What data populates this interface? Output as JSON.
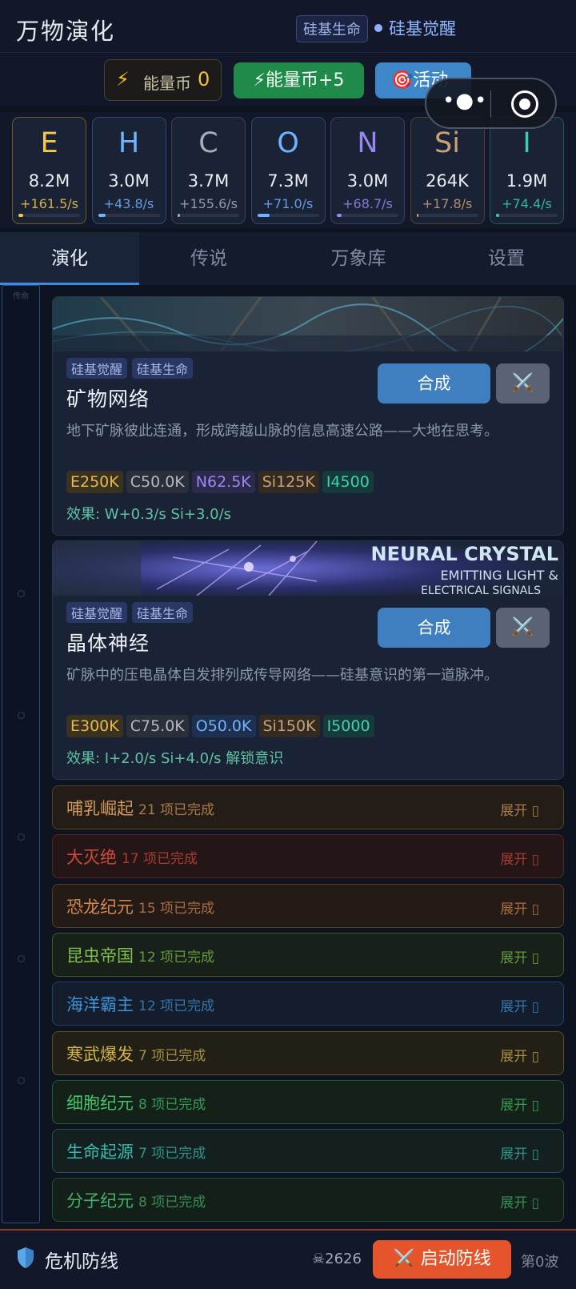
{
  "header": {
    "title": "万物演化",
    "stage_badge": "硅基生命",
    "stage_current": "硅基觉醒"
  },
  "energy": {
    "bolt_icon": "⚡",
    "label": "能量币",
    "value": "0",
    "add_button": "⚡能量币+5",
    "activity_button": "🎯活动"
  },
  "resources": [
    {
      "symbol": "E",
      "amount": "8.2M",
      "rate": "+161.5/s",
      "color": "#f6c84a",
      "border": "#6e5b26",
      "fill": 0.08
    },
    {
      "symbol": "H",
      "amount": "3.0M",
      "rate": "+43.8/s",
      "color": "#6fb2ff",
      "border": "#2f4a73",
      "fill": 0.12
    },
    {
      "symbol": "C",
      "amount": "3.7M",
      "rate": "+155.6/s",
      "color": "#a8adb8",
      "border": "#3b4150",
      "fill": 0.04
    },
    {
      "symbol": "O",
      "amount": "7.3M",
      "rate": "+71.0/s",
      "color": "#6fb2ff",
      "border": "#2f4a73",
      "fill": 0.2
    },
    {
      "symbol": "N",
      "amount": "3.0M",
      "rate": "+68.7/s",
      "color": "#9a86f0",
      "border": "#3c3a66",
      "fill": 0.08
    },
    {
      "symbol": "Si",
      "amount": "264K",
      "rate": "+17.8/s",
      "color": "#c9a273",
      "border": "#4d4030",
      "fill": 0.03
    },
    {
      "symbol": "I",
      "amount": "1.9M",
      "rate": "+74.4/s",
      "color": "#39d0b0",
      "border": "#1f5a56",
      "fill": 0.05
    }
  ],
  "tabs": [
    "演化",
    "传说",
    "万象库",
    "设置"
  ],
  "rail_label": "传命",
  "recipes": [
    {
      "tags": [
        "硅基觉醒",
        "硅基生命"
      ],
      "name": "矿物网络",
      "desc": "地下矿脉彼此连通，形成跨越山脉的信息高速公路——大地在思考。",
      "costs": [
        {
          "text": "E250K",
          "color": "#e7b84a",
          "bg": "#3a3220"
        },
        {
          "text": "C50.0K",
          "color": "#b4b8c2",
          "bg": "#2a2f3a"
        },
        {
          "text": "N62.5K",
          "color": "#9c88f0",
          "bg": "#2c2a4a"
        },
        {
          "text": "Si125K",
          "color": "#c9a273",
          "bg": "#332b22"
        },
        {
          "text": "I4500",
          "color": "#3fd1b1",
          "bg": "#16393a"
        }
      ],
      "effect": "效果: W+0.3/s  Si+3.0/s",
      "synth": "合成",
      "fight_icon": "⚔️"
    },
    {
      "tags": [
        "硅基觉醒",
        "硅基生命"
      ],
      "name": "晶体神经",
      "desc": "矿脉中的压电晶体自发排列成传导网络——硅基意识的第一道脉冲。",
      "banner_text": [
        "NEURAL CRYSTAL",
        "EMITTING LIGHT &",
        "ELECTRICAL SIGNALS"
      ],
      "costs": [
        {
          "text": "E300K",
          "color": "#e7b84a",
          "bg": "#3a3220"
        },
        {
          "text": "C75.0K",
          "color": "#b4b8c2",
          "bg": "#2a2f3a"
        },
        {
          "text": "O50.0K",
          "color": "#6fb2ff",
          "bg": "#1e3050"
        },
        {
          "text": "Si150K",
          "color": "#c9a273",
          "bg": "#332b22"
        },
        {
          "text": "I5000",
          "color": "#3fd1b1",
          "bg": "#16393a"
        }
      ],
      "effect": "效果: I+2.0/s  Si+4.0/s  解锁意识",
      "synth": "合成",
      "fight_icon": "⚔️"
    }
  ],
  "eras": [
    {
      "name": "哺乳崛起",
      "count": "21 项已完成",
      "expand": "展开 ▯",
      "color": "#d39a5a",
      "bg": "#231c17",
      "border": "#5a4126"
    },
    {
      "name": "大灭绝",
      "count": "17 项已完成",
      "expand": "展开 ▯",
      "color": "#d04a3c",
      "bg": "#241517",
      "border": "#5a2420"
    },
    {
      "name": "恐龙纪元",
      "count": "15 项已完成",
      "expand": "展开 ▯",
      "color": "#d7874d",
      "bg": "#241b17",
      "border": "#5c3a22"
    },
    {
      "name": "昆虫帝国",
      "count": "12 项已完成",
      "expand": "展开 ▯",
      "color": "#7fc14a",
      "bg": "#172019",
      "border": "#3d5a22"
    },
    {
      "name": "海洋霸主",
      "count": "12 项已完成",
      "expand": "展开 ▯",
      "color": "#3f92d9",
      "bg": "#131d2b",
      "border": "#21426a"
    },
    {
      "name": "寒武爆发",
      "count": "7 项已完成",
      "expand": "展开 ▯",
      "color": "#d1b44a",
      "bg": "#221f17",
      "border": "#5a4e22"
    },
    {
      "name": "细胞纪元",
      "count": "8 项已完成",
      "expand": "展开 ▯",
      "color": "#43c06a",
      "bg": "#132119",
      "border": "#22592f"
    },
    {
      "name": "生命起源",
      "count": "7 项已完成",
      "expand": "展开 ▯",
      "color": "#3ab9ae",
      "bg": "#13201f",
      "border": "#1f5550"
    },
    {
      "name": "分子纪元",
      "count": "8 项已完成",
      "expand": "展开 ▯",
      "color": "#47b06a",
      "bg": "#131f19",
      "border": "#22502f"
    }
  ],
  "bottom": {
    "title": "危机防线",
    "kills": "☠2626",
    "start_button": "⚔️ 启动防线",
    "wave": "第0波"
  }
}
